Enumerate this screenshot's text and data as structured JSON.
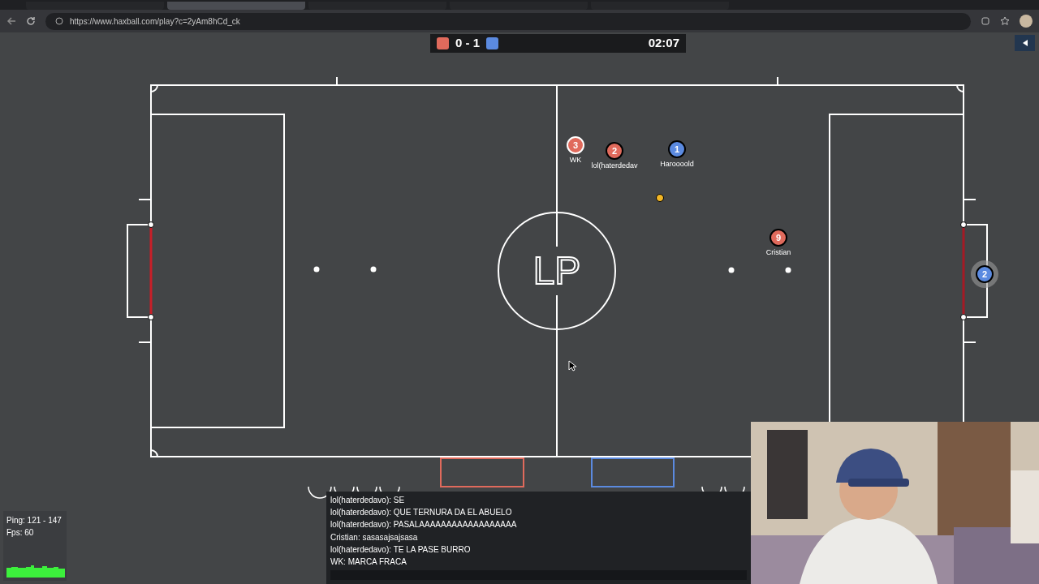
{
  "browser": {
    "tabs": [
      {
        "selected": false
      },
      {
        "selected": true
      },
      {
        "selected": false
      },
      {
        "selected": false
      },
      {
        "selected": false
      }
    ],
    "url": "https://www.haxball.com/play?c=2yAm8hCd_ck"
  },
  "scoreboard": {
    "score": "0 - 1",
    "time": "02:07"
  },
  "field": {
    "center_logo": "LP"
  },
  "players": [
    {
      "number": "3",
      "name": "WK",
      "color": "#e06a5c",
      "outlined": true,
      "halo": false
    },
    {
      "number": "2",
      "name": "lol(haterdedav",
      "color": "#e06a5c",
      "outlined": false,
      "halo": false
    },
    {
      "number": "1",
      "name": "Haroooold",
      "color": "#5b8ae0",
      "outlined": false,
      "halo": false
    },
    {
      "number": "9",
      "name": "Cristian",
      "color": "#e06a5c",
      "outlined": false,
      "halo": false
    },
    {
      "number": "2",
      "color": "#5b8ae0",
      "outlined": false,
      "halo": true
    }
  ],
  "stats": {
    "ping": "Ping: 121 - 147",
    "fps": "Fps: 60"
  },
  "chat": {
    "messages": [
      "lol(haterdedavo): SE",
      "lol(haterdedavo): QUE TERNURA DA EL ABUELO",
      "lol(haterdedavo): PASALAAAAAAAAAAAAAAAAAA",
      "Cristian: sasasajsajsasa",
      "lol(haterdedavo): TE LA PASE BURRO",
      "WK: MARCA FRACA"
    ]
  }
}
